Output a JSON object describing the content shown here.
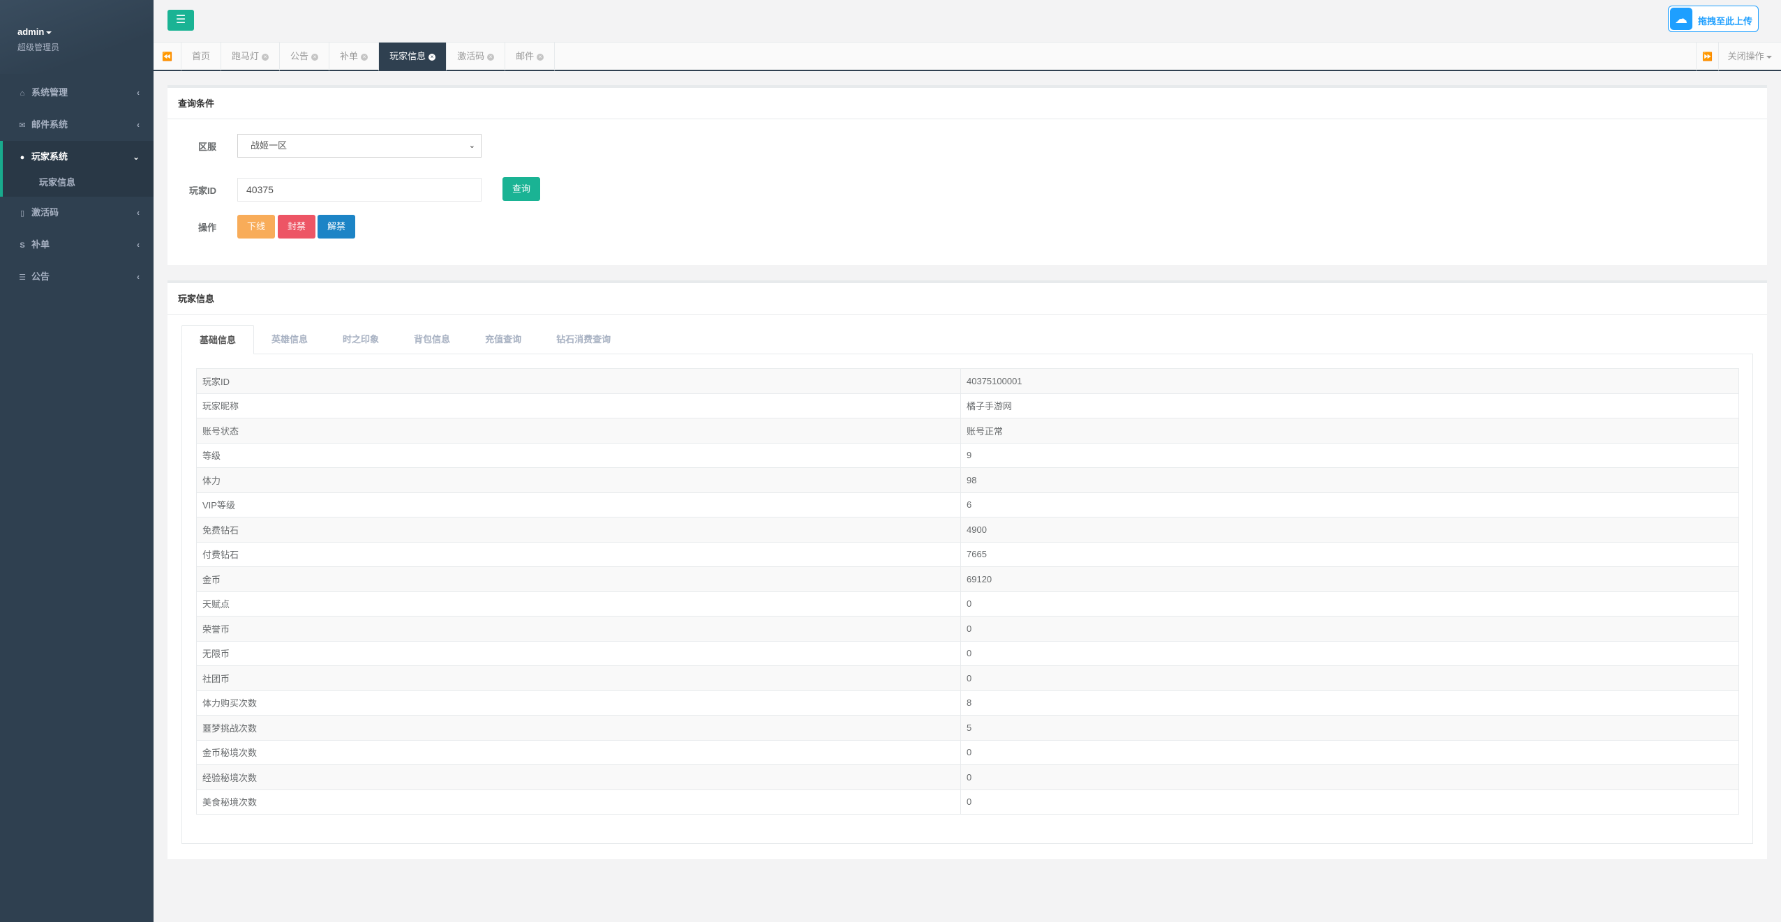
{
  "sidebar": {
    "profile": {
      "name": "admin",
      "role": "超级管理员"
    },
    "items": [
      {
        "label": "系统管理",
        "icon": "home-icon",
        "glyph": "⌂",
        "arrow": "‹"
      },
      {
        "label": "邮件系统",
        "icon": "envelope-icon",
        "glyph": "✉",
        "arrow": "‹"
      },
      {
        "label": "玩家系统",
        "icon": "user-icon",
        "glyph": "●",
        "arrow": "⌄"
      },
      {
        "label": "激活码",
        "icon": "document-icon",
        "glyph": "▯",
        "arrow": "‹"
      },
      {
        "label": "补单",
        "icon": "strikethrough-icon",
        "glyph": "S",
        "arrow": "‹"
      },
      {
        "label": "公告",
        "icon": "list-icon",
        "glyph": "☰",
        "arrow": "‹"
      }
    ],
    "submenu": {
      "label": "玩家信息"
    }
  },
  "topbar": {
    "menu_icon": "☰",
    "upload": {
      "label": "拖拽至此上传",
      "icon": "cloud-icon",
      "glyph": "☁"
    }
  },
  "tabs": {
    "left_nav": "⏪",
    "right_nav": "⏩",
    "items": [
      {
        "label": "首页"
      },
      {
        "label": "跑马灯",
        "x": "×"
      },
      {
        "label": "公告",
        "x": "×"
      },
      {
        "label": "补单",
        "x": "×"
      },
      {
        "label": "玩家信息",
        "x": "×"
      },
      {
        "label": "激活码",
        "x": "×"
      },
      {
        "label": "邮件",
        "x": "×"
      }
    ],
    "close_ops": "关闭操作"
  },
  "query": {
    "title": "查询条件",
    "server_label": "区服",
    "server_value": "战姬一区",
    "chev": "⌄",
    "player_id_label": "玩家ID",
    "player_id_value": "40375",
    "query_button": "查询",
    "ops_label": "操作",
    "offline_button": "下线",
    "ban_button": "封禁",
    "unban_button": "解禁"
  },
  "player": {
    "title": "玩家信息",
    "tabs": [
      "基础信息",
      "英雄信息",
      "时之印象",
      "背包信息",
      "充值查询",
      "钻石消费查询"
    ],
    "rows": [
      {
        "key": "玩家ID",
        "value": "40375100001"
      },
      {
        "key": "玩家昵称",
        "value": "橘子手游网"
      },
      {
        "key": "账号状态",
        "value": "账号正常"
      },
      {
        "key": "等级",
        "value": "9"
      },
      {
        "key": "体力",
        "value": "98"
      },
      {
        "key": "VIP等级",
        "value": "6"
      },
      {
        "key": "免费钻石",
        "value": "4900"
      },
      {
        "key": "付费钻石",
        "value": "7665"
      },
      {
        "key": "金币",
        "value": "69120"
      },
      {
        "key": "天赋点",
        "value": "0"
      },
      {
        "key": "荣誉币",
        "value": "0"
      },
      {
        "key": "无限币",
        "value": "0"
      },
      {
        "key": "社团币",
        "value": "0"
      },
      {
        "key": "体力购买次数",
        "value": "8"
      },
      {
        "key": "噩梦挑战次数",
        "value": "5"
      },
      {
        "key": "金币秘境次数",
        "value": "0"
      },
      {
        "key": "经验秘境次数",
        "value": "0"
      },
      {
        "key": "美食秘境次数",
        "value": "0"
      }
    ]
  },
  "colors": {
    "sidebar": "#2f4050",
    "accent": "#1ab394",
    "warning": "#f8ac59",
    "danger": "#ed5565",
    "info": "#1c84c6",
    "upload": "#1e9fff"
  }
}
